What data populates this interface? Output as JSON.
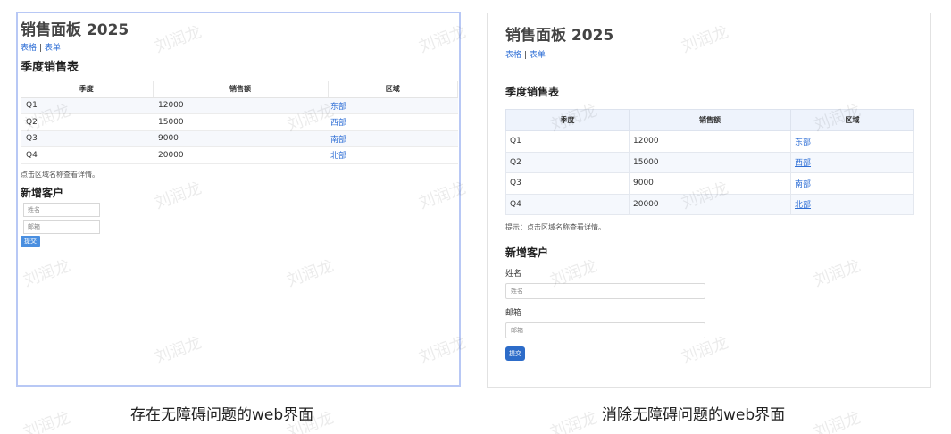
{
  "watermark": "刘润龙",
  "left": {
    "title": "销售面板 2025",
    "nav": {
      "link1": "表格",
      "separator": "|",
      "link2": "表单"
    },
    "table_title": "季度销售表",
    "columns": [
      "季度",
      "销售额",
      "区域"
    ],
    "rows": [
      {
        "quarter": "Q1",
        "sales": "12000",
        "region": "东部"
      },
      {
        "quarter": "Q2",
        "sales": "15000",
        "region": "西部"
      },
      {
        "quarter": "Q3",
        "sales": "9000",
        "region": "南部"
      },
      {
        "quarter": "Q4",
        "sales": "20000",
        "region": "北部"
      }
    ],
    "hint": "点击区域名称查看详情。",
    "form_title": "新增客户",
    "name_placeholder": "姓名",
    "email_placeholder": "邮箱",
    "submit": "提交"
  },
  "right": {
    "title": "销售面板 2025",
    "nav": {
      "link1": "表格",
      "separator": "|",
      "link2": "表单"
    },
    "table_title": "季度销售表",
    "columns": [
      "季度",
      "销售额",
      "区域"
    ],
    "rows": [
      {
        "quarter": "Q1",
        "sales": "12000",
        "region": "东部"
      },
      {
        "quarter": "Q2",
        "sales": "15000",
        "region": "西部"
      },
      {
        "quarter": "Q3",
        "sales": "9000",
        "region": "南部"
      },
      {
        "quarter": "Q4",
        "sales": "20000",
        "region": "北部"
      }
    ],
    "hint": "提示：点击区域名称查看详情。",
    "form_title": "新增客户",
    "name_label": "姓名",
    "name_placeholder": "姓名",
    "email_label": "邮箱",
    "email_placeholder": "邮箱",
    "submit": "提交"
  },
  "captions": {
    "left": "存在无障碍问题的web界面",
    "right": "消除无障碍问题的web界面"
  },
  "colors": {
    "link": "#2f6fd6",
    "left_border": "#b8c8f5",
    "right_button": "#2d6cc9",
    "left_button": "#4a8fe0",
    "table_header_bg": "#eef3fc"
  }
}
